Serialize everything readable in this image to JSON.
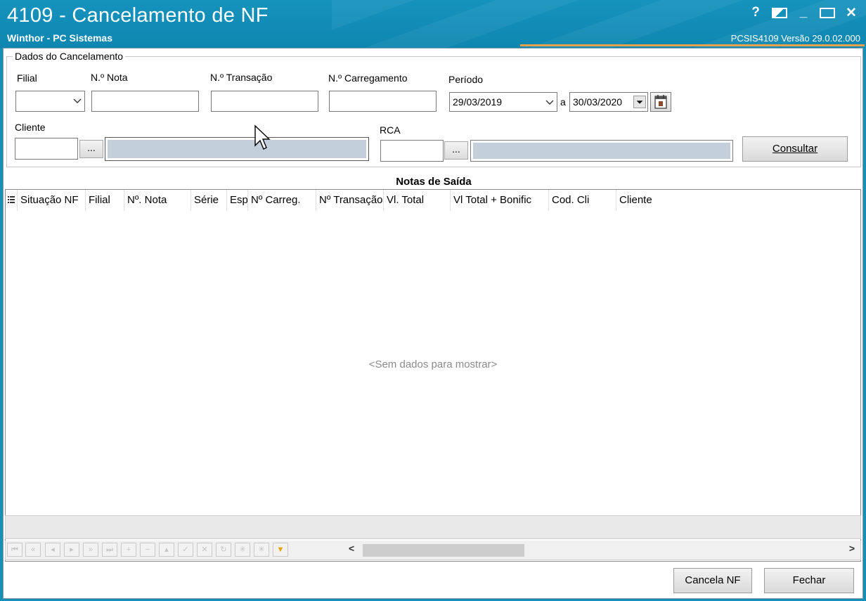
{
  "window": {
    "title": "4109 - Cancelamento de NF",
    "subtitle": "Winthor - PC Sistemas",
    "version": "PCSIS4109  Versão  29.0.02.000",
    "controls": {
      "help": "?",
      "minimize": "_",
      "close": "✕"
    }
  },
  "colors": {
    "titlebar": "#1693bd",
    "accent": "#e9a14b",
    "readonly_field": "#c3d0dc"
  },
  "filters": {
    "group_title": "Dados do Cancelamento",
    "filial": {
      "label": "Filial",
      "value": ""
    },
    "nota": {
      "label": "N.º Nota",
      "value": ""
    },
    "transacao": {
      "label": "N.º Transação",
      "value": ""
    },
    "carregamento": {
      "label": "N.º Carregamento",
      "value": ""
    },
    "periodo": {
      "label": "Período",
      "start": "29/03/2019",
      "separator": "a",
      "end": "30/03/2020"
    },
    "cliente": {
      "label": "Cliente",
      "code": "",
      "name": "",
      "lookup": "..."
    },
    "rca": {
      "label": "RCA",
      "code": "",
      "name": "",
      "lookup": "..."
    },
    "consultar": "Consultar"
  },
  "grid": {
    "title": "Notas de Saída",
    "columns": [
      "Situação NF",
      "Filial",
      "Nº. Nota",
      "Série",
      "Esp",
      "Nº Carreg.",
      "Nº Transação",
      "Vl. Total",
      "Vl Total + Bonific",
      "Cod. Cli",
      "Cliente"
    ],
    "empty_text": "<Sem dados para mostrar>"
  },
  "footer": {
    "cancel_nf": "Cancela NF",
    "close": "Fechar"
  }
}
